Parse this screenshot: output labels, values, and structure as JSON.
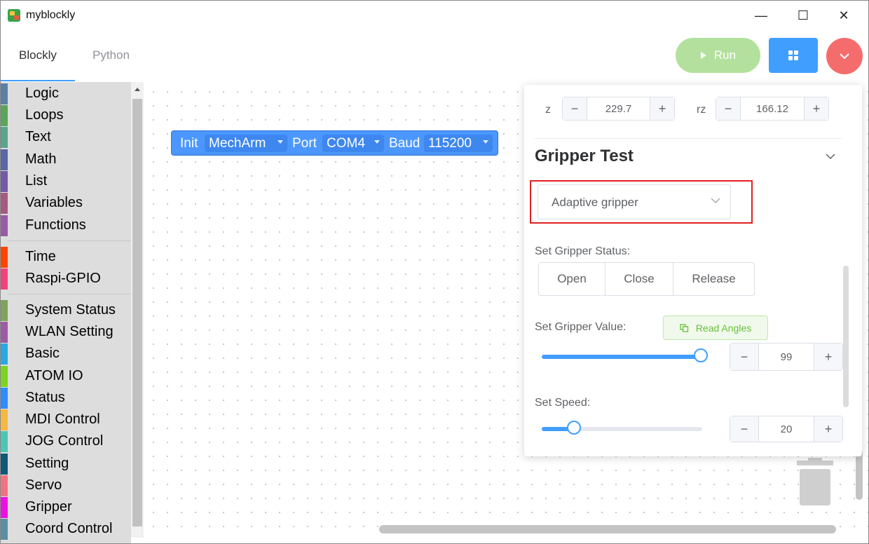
{
  "window": {
    "title": "myblockly",
    "minimize": "—",
    "maximize": "☐",
    "close": "✕"
  },
  "tabs": [
    {
      "label": "Blockly",
      "active": true
    },
    {
      "label": "Python",
      "active": false
    }
  ],
  "toolbar": {
    "run_label": "Run",
    "grid_icon": "grid-icon",
    "dropdown_icon": "chevron-down-icon"
  },
  "toolbox": {
    "categories": [
      {
        "label": "Logic",
        "color": "#5b80a5"
      },
      {
        "label": "Loops",
        "color": "#5ba55b"
      },
      {
        "label": "Text",
        "color": "#5ba58c"
      },
      {
        "label": "Math",
        "color": "#5b67a5"
      },
      {
        "label": "List",
        "color": "#745ba5"
      },
      {
        "label": "Variables",
        "color": "#a55b80"
      },
      {
        "label": "Functions",
        "color": "#995ba5"
      },
      {
        "label": "Time",
        "color": "#ff4500"
      },
      {
        "label": "Raspi-GPIO",
        "color": "#f0437c"
      },
      {
        "label": "System Status",
        "color": "#7ea55b"
      },
      {
        "label": "WLAN Setting",
        "color": "#9e5ba5"
      },
      {
        "label": "Basic",
        "color": "#2ba8e0"
      },
      {
        "label": "ATOM IO",
        "color": "#7ed321"
      },
      {
        "label": "Status",
        "color": "#2f8cff"
      },
      {
        "label": "MDI Control",
        "color": "#f5b942"
      },
      {
        "label": "JOG Control",
        "color": "#4ec5b5"
      },
      {
        "label": "Setting",
        "color": "#0f5a77"
      },
      {
        "label": "Servo",
        "color": "#f27380"
      },
      {
        "label": "Gripper",
        "color": "#ec11e0"
      },
      {
        "label": "Coord Control",
        "color": "#5d8ea1"
      }
    ]
  },
  "block": {
    "init": "Init",
    "arm": "MechArm",
    "port_label": "Port",
    "port": "COM4",
    "baud_label": "Baud",
    "baud": "115200"
  },
  "panel": {
    "z_label": "z",
    "z_value": "229.7",
    "rz_label": "rz",
    "rz_value": "166.12",
    "minus": "−",
    "plus": "+",
    "section_title": "Gripper Test",
    "gripper_type": "Adaptive gripper",
    "status_label": "Set Gripper Status:",
    "status_buttons": [
      "Open",
      "Close",
      "Release"
    ],
    "value_label": "Set Gripper Value:",
    "read_angles": "Read Angles",
    "gripper_value": "99",
    "gripper_value_fraction": 0.99,
    "speed_label": "Set Speed:",
    "speed_value": "20",
    "speed_fraction": 0.2,
    "accent_color": "#409eff",
    "highlight_color": "#e02020"
  }
}
